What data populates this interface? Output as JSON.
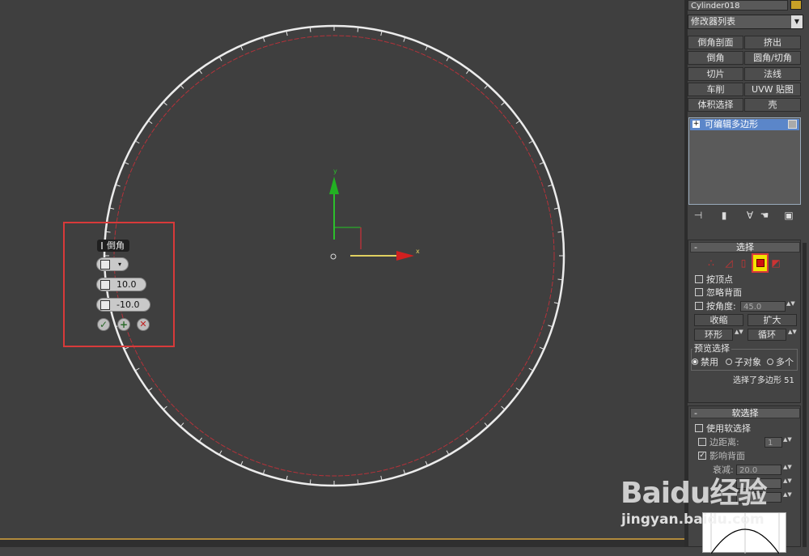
{
  "viewport": {
    "axis_x_label": "x",
    "axis_y_label": "y"
  },
  "caddy": {
    "title": "倒角",
    "type_value": "",
    "height_value": "10.0",
    "outline_value": "-10.0",
    "ok_symbol": "✓",
    "apply_symbol": "+",
    "cancel_symbol": "✕"
  },
  "panel": {
    "object_name": "Cylinder018",
    "object_color": "#c9a227",
    "modifier_list_label": "修改器列表",
    "modifier_buttons": [
      "倒角剖面",
      "挤出",
      "倒角",
      "圆角/切角",
      "切片",
      "法线",
      "车削",
      "UVW 贴图",
      "体积选择",
      "壳"
    ],
    "stack_item": "可编辑多边形",
    "selection": {
      "title": "选择",
      "by_vertex": "按顶点",
      "ignore_backfacing": "忽略背面",
      "by_angle": "按角度:",
      "angle_value": "45.0",
      "shrink": "收缩",
      "grow": "扩大",
      "ring": "环形",
      "loop": "循环",
      "preview_label": "预览选择",
      "preview_off": "禁用",
      "preview_subobj": "子对象",
      "preview_multi": "多个",
      "status": "选择了多边形 51"
    },
    "soft_selection": {
      "title": "软选择",
      "use_soft": "使用软选择",
      "edge_distance": "边距离:",
      "edge_distance_value": "1",
      "affect_backfacing": "影响背面",
      "falloff_label": "衰减:",
      "falloff_value": "20.0"
    }
  },
  "watermark": {
    "logo": "Baidu经验",
    "url": "jingyan.baidu.com"
  }
}
